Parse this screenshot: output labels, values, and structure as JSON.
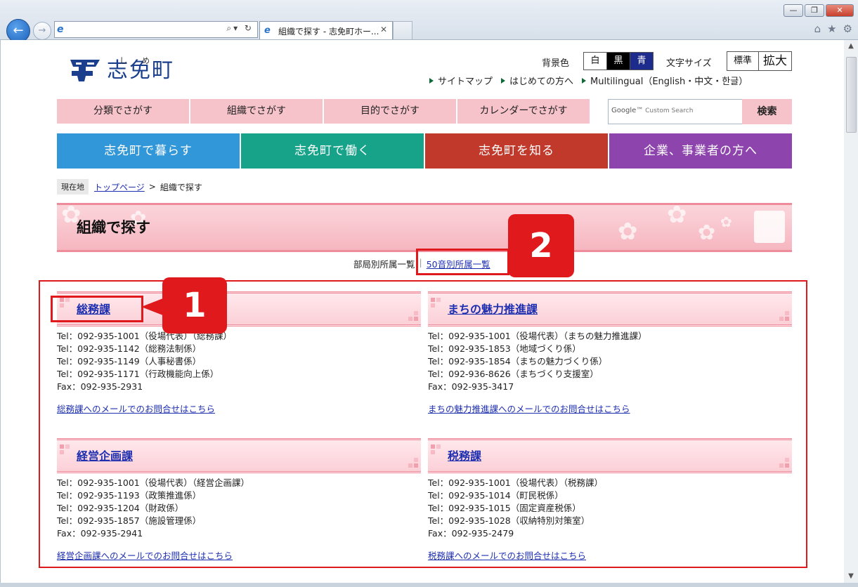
{
  "browser": {
    "tab_title": "組織で探す - 志免町ホー...",
    "tab_close": "✕",
    "win_min": "—",
    "win_max": "❐",
    "win_close": "✕",
    "back": "←",
    "forward": "→",
    "addr_icon": "e",
    "addr_tools": "⌕▾ ↻",
    "toolbar": {
      "home": "⌂",
      "star": "★",
      "gear": "⚙"
    },
    "sb_up": "▲",
    "sb_down": "▼"
  },
  "header": {
    "logo_name": "志免町",
    "logo_ruby": [
      "し",
      "め"
    ],
    "bg_label": "背景色",
    "bg_options": [
      "白",
      "黒",
      "青"
    ],
    "fs_label": "文字サイズ",
    "fs_options": [
      "標準",
      "拡大"
    ],
    "links": [
      "サイトマップ",
      "はじめての方へ",
      "Multilingual（English・中文・한글）"
    ]
  },
  "nav1": [
    "分類でさがす",
    "組織でさがす",
    "目的でさがす",
    "カレンダーでさがす"
  ],
  "search": {
    "placeholder_brand": "Google™",
    "placeholder_text": "Custom Search",
    "button": "検索"
  },
  "nav2": [
    {
      "label": "志免町で暮らす",
      "color": "#3297d8"
    },
    {
      "label": "志免町で働く",
      "color": "#17a389"
    },
    {
      "label": "志免町を知る",
      "color": "#c0392b"
    },
    {
      "label": "企業、事業者の方へ",
      "color": "#8e44ad"
    }
  ],
  "breadcrumb": {
    "label": "現在地",
    "home": "トップページ",
    "sep": ">",
    "current": "組織で探す"
  },
  "page_title": "組織で探す",
  "subtabs": {
    "by_dept": "部局別所属一覧",
    "sep": "|",
    "by_kana": "50音別所属一覧"
  },
  "departments": [
    {
      "name": "総務課",
      "lines": [
        "Tel：092-935-1001（役場代表）（総務課）",
        "Tel：092-935-1142（総務法制係）",
        "Tel：092-935-1149（人事秘書係）",
        "Tel：092-935-1171（行政機能向上係）",
        "Fax：092-935-2931"
      ],
      "mail": "総務課へのメールでのお問合せはこちら"
    },
    {
      "name": "まちの魅力推進課",
      "lines": [
        "Tel：092-935-1001（役場代表）（まちの魅力推進課）",
        "Tel：092-935-1853（地域づくり係）",
        "Tel：092-935-1854（まちの魅力づくり係）",
        "Tel：092-936-8626（まちづくり支援室）",
        "Fax：092-935-3417"
      ],
      "mail": "まちの魅力推進課へのメールでのお問合せはこちら"
    },
    {
      "name": "経営企画課",
      "lines": [
        "Tel：092-935-1001（役場代表）（経営企画課）",
        "Tel：092-935-1193（政策推進係）",
        "Tel：092-935-1204（財政係）",
        "Tel：092-935-1857（施設管理係）",
        "Fax：092-935-2941"
      ],
      "mail": "経営企画課へのメールでのお問合せはこちら"
    },
    {
      "name": "税務課",
      "lines": [
        "Tel：092-935-1001（役場代表）（税務課）",
        "Tel：092-935-1014（町民税係）",
        "Tel：092-935-1015（固定資産税係）",
        "Tel：092-935-1028（収納特別対策室）",
        "Fax：092-935-2479"
      ],
      "mail": "税務課へのメールでのお問合せはこちら"
    }
  ],
  "annotations": {
    "callout1": "1",
    "callout2": "2"
  },
  "colors": {
    "accent_red": "#e0191d",
    "pink": "#f7c3cb",
    "link": "#1e2fb0"
  }
}
